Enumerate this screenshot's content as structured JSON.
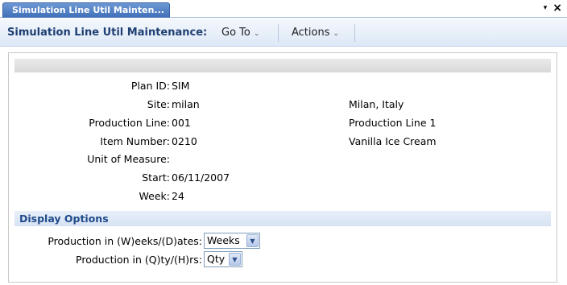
{
  "tab": {
    "title": "Simulation Line Util Mainten...",
    "menu_arrow": "▾",
    "close": "×"
  },
  "toolbar": {
    "title": "Simulation Line Util Maintenance:",
    "goto_label": "Go To",
    "actions_label": "Actions",
    "chevron": "⌄"
  },
  "fields": [
    {
      "label": "Plan ID:",
      "value": "SIM",
      "desc": ""
    },
    {
      "label": "Site:",
      "value": "milan",
      "desc": "Milan, Italy"
    },
    {
      "label": "Production Line:",
      "value": "001",
      "desc": "Production Line 1"
    },
    {
      "label": "Item Number:",
      "value": "0210",
      "desc": "Vanilla Ice Cream"
    },
    {
      "label": "Unit of Measure:",
      "value": "",
      "desc": ""
    },
    {
      "label": "Start:",
      "value": "06/11/2007",
      "desc": ""
    },
    {
      "label": "Week:",
      "value": "24",
      "desc": ""
    }
  ],
  "display_options": {
    "title": "Display Options",
    "weeks_dates": {
      "label": "Production in (W)eeks/(D)ates:",
      "selected": "Weeks"
    },
    "qty_hrs": {
      "label": "Production in (Q)ty/(H)rs:",
      "selected": "Qty"
    }
  }
}
